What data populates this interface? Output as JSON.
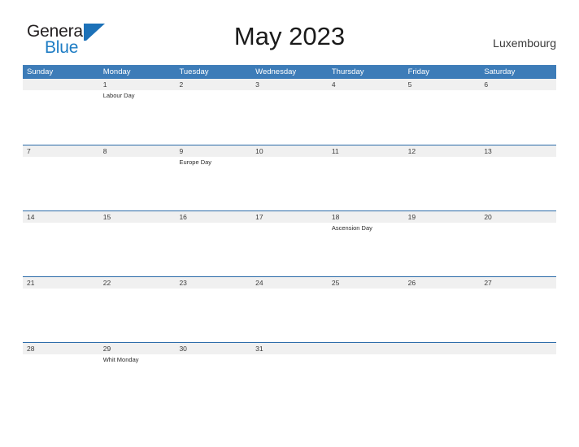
{
  "logo": {
    "word_one": "General",
    "word_two": "Blue",
    "mark_name": "general-blue-triangle-mark",
    "colors": {
      "word_one": "#231f20",
      "word_two": "#1d7cc4",
      "mark": "#1c71b8"
    }
  },
  "header": {
    "title": "May 2023",
    "country": "Luxembourg"
  },
  "theme": {
    "header_blue": "#3d7cb8",
    "row_rule_blue": "#2a6aa8",
    "date_band_gray": "#f0f0f0",
    "page_background": "#ffffff",
    "text_dark": "#3a3a3a"
  },
  "calendar": {
    "month": "May",
    "year": "2023",
    "weekday_headers": [
      "Sunday",
      "Monday",
      "Tuesday",
      "Wednesday",
      "Thursday",
      "Friday",
      "Saturday"
    ],
    "weeks": [
      {
        "days": [
          {
            "date": "",
            "events": []
          },
          {
            "date": "1",
            "events": [
              "Labour Day"
            ]
          },
          {
            "date": "2",
            "events": []
          },
          {
            "date": "3",
            "events": []
          },
          {
            "date": "4",
            "events": []
          },
          {
            "date": "5",
            "events": []
          },
          {
            "date": "6",
            "events": []
          }
        ]
      },
      {
        "days": [
          {
            "date": "7",
            "events": []
          },
          {
            "date": "8",
            "events": []
          },
          {
            "date": "9",
            "events": [
              "Europe Day"
            ]
          },
          {
            "date": "10",
            "events": []
          },
          {
            "date": "11",
            "events": []
          },
          {
            "date": "12",
            "events": []
          },
          {
            "date": "13",
            "events": []
          }
        ]
      },
      {
        "days": [
          {
            "date": "14",
            "events": []
          },
          {
            "date": "15",
            "events": []
          },
          {
            "date": "16",
            "events": []
          },
          {
            "date": "17",
            "events": []
          },
          {
            "date": "18",
            "events": [
              "Ascension Day"
            ]
          },
          {
            "date": "19",
            "events": []
          },
          {
            "date": "20",
            "events": []
          }
        ]
      },
      {
        "days": [
          {
            "date": "21",
            "events": []
          },
          {
            "date": "22",
            "events": []
          },
          {
            "date": "23",
            "events": []
          },
          {
            "date": "24",
            "events": []
          },
          {
            "date": "25",
            "events": []
          },
          {
            "date": "26",
            "events": []
          },
          {
            "date": "27",
            "events": []
          }
        ]
      },
      {
        "days": [
          {
            "date": "28",
            "events": []
          },
          {
            "date": "29",
            "events": [
              "Whit Monday"
            ]
          },
          {
            "date": "30",
            "events": []
          },
          {
            "date": "31",
            "events": []
          },
          {
            "date": "",
            "events": []
          },
          {
            "date": "",
            "events": []
          },
          {
            "date": "",
            "events": []
          }
        ]
      }
    ]
  }
}
